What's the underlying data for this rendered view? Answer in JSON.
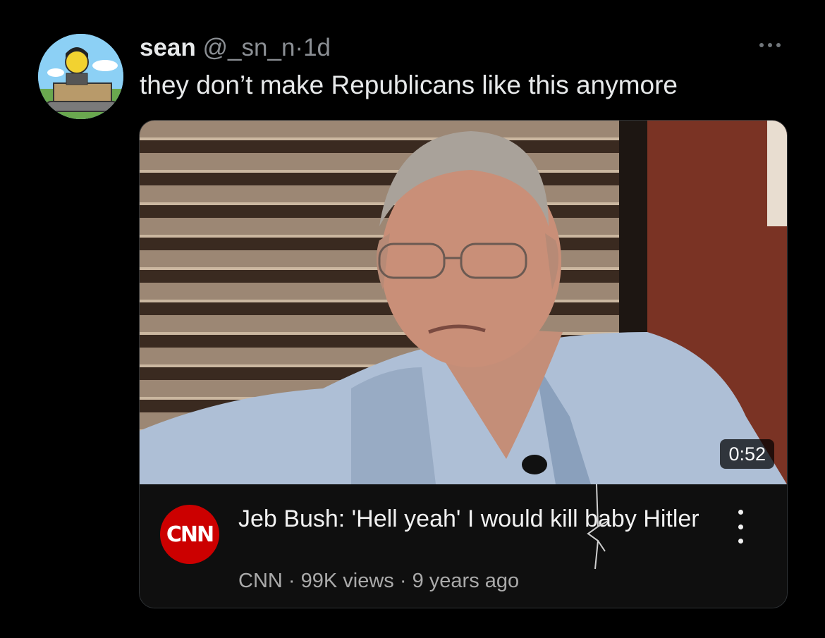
{
  "tweet": {
    "author_name": "sean",
    "handle": "@_sn_n",
    "separator": "·",
    "age": "1d",
    "text": "they don’t make Republicans like this anymore"
  },
  "video_card": {
    "duration": "0:52",
    "title": "Jeb Bush: 'Hell yeah' I would kill baby Hitler",
    "channel_logo_text": "CNN",
    "channel": "CNN",
    "views": "99K views",
    "uploaded": "9 years ago",
    "dot": "·"
  },
  "colors": {
    "background": "#000000",
    "secondary_text": "#8b8f94",
    "card_background": "#0f0f0f",
    "cnn_red": "#cc0000"
  }
}
